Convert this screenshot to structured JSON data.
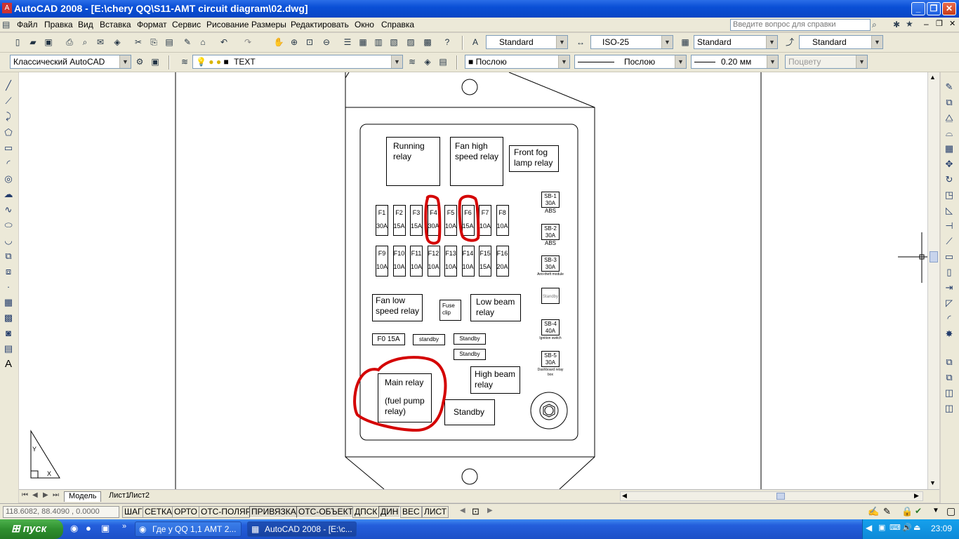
{
  "window": {
    "title": "AutoCAD 2008 - [E:\\chery QQ\\S11-AMT circuit diagram\\02.dwg]"
  },
  "menu": [
    "Файл",
    "Правка",
    "Вид",
    "Вставка",
    "Формат",
    "Сервис",
    "Рисование",
    "Размеры",
    "Редактировать",
    "Окно",
    "Справка"
  ],
  "help_placeholder": "Введите вопрос для справки",
  "toolbar_styles": {
    "text_style": "Standard",
    "dim_style": "ISO-25",
    "table_style": "Standard",
    "mleader_style": "Standard"
  },
  "toolbar_layers": {
    "workspace": "Классический AutoCAD",
    "layer": "TEXT",
    "color": "Послою",
    "linetype": "Послою",
    "lineweight": "0.20 мм",
    "plotstyle": "Поцвету"
  },
  "drawing": {
    "relays": {
      "running": [
        "Running",
        "relay"
      ],
      "fan_high": [
        "Fan high",
        "speed relay"
      ],
      "front_fog": [
        "Front fog",
        "lamp relay"
      ],
      "fan_low": [
        "Fan low",
        "speed relay"
      ],
      "fuse_clip": [
        "Fuse",
        "clip"
      ],
      "low_beam": [
        "Low beam",
        "relay"
      ],
      "high_beam": [
        "High beam",
        "relay"
      ],
      "main_relay": [
        "Main relay",
        "(fuel pump",
        "relay)"
      ],
      "standby_big": "Standby"
    },
    "fuses_row1": [
      {
        "name": "F1",
        "rating": "30A"
      },
      {
        "name": "F2",
        "rating": "15A"
      },
      {
        "name": "F3",
        "rating": "15A"
      },
      {
        "name": "F4",
        "rating": "30A"
      },
      {
        "name": "F5",
        "rating": "10A"
      },
      {
        "name": "F6",
        "rating": "15A"
      },
      {
        "name": "F7",
        "rating": "10A"
      },
      {
        "name": "F8",
        "rating": "10A"
      }
    ],
    "fuses_row2": [
      {
        "name": "F9",
        "rating": "10A"
      },
      {
        "name": "F10",
        "rating": "10A"
      },
      {
        "name": "F11",
        "rating": "10A"
      },
      {
        "name": "F12",
        "rating": "10A"
      },
      {
        "name": "F13",
        "rating": "10A"
      },
      {
        "name": "F14",
        "rating": "10A"
      },
      {
        "name": "F15",
        "rating": "15A"
      },
      {
        "name": "F16",
        "rating": "20A"
      }
    ],
    "small_boxes": {
      "f0": "F0 15A",
      "standby1": "standby",
      "standby2": "Standby",
      "standby3": "Standby"
    },
    "sb_fuses": [
      {
        "name": "SB-1",
        "rating": "30A",
        "label": "ABS"
      },
      {
        "name": "SB-2",
        "rating": "30A",
        "label": "ABS"
      },
      {
        "name": "SB-3",
        "rating": "30A",
        "label": "Anti-theft module"
      },
      {
        "name": "Standby",
        "rating": "",
        "label": ""
      },
      {
        "name": "SB-4",
        "rating": "40A",
        "label": "Ignition switch"
      },
      {
        "name": "SB-5",
        "rating": "30A",
        "label": "Dashboard relay box"
      }
    ],
    "highlight_color": "#d40000"
  },
  "layout_tabs": [
    "Модель",
    "Лист1",
    "Лист2"
  ],
  "status": {
    "coords": "118.6082, 88.4090 , 0.0000",
    "buttons": [
      "ШАГ",
      "СЕТКА",
      "ОРТО",
      "ОТС-ПОЛЯР",
      "ПРИВЯЗКА",
      "ОТС-ОБЪЕКТ",
      "ДПСК",
      "ДИН",
      "ВЕС",
      "ЛИСТ"
    ]
  },
  "taskbar": {
    "start": "пуск",
    "tasks": [
      "Где у QQ 1,1 АМТ 2...",
      "AutoCAD 2008 - [E:\\c..."
    ],
    "clock": "23:09"
  }
}
